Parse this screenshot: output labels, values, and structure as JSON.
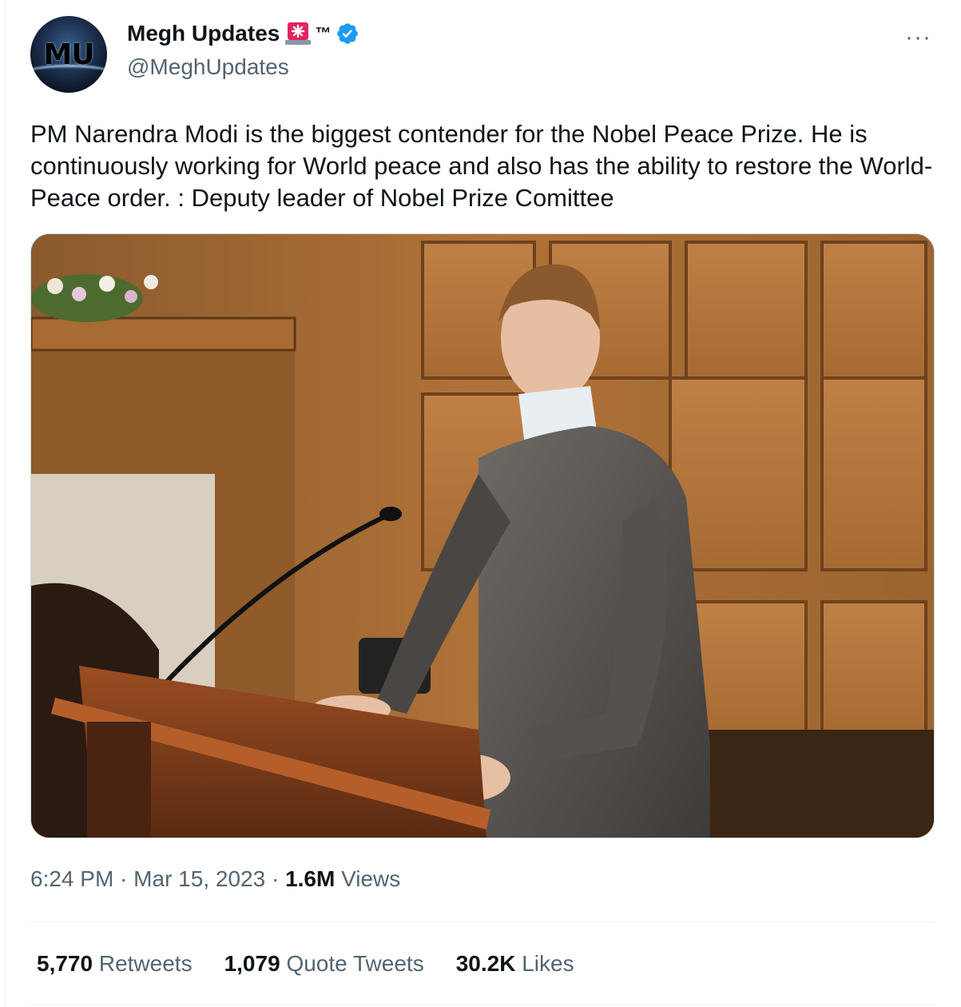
{
  "author": {
    "display_name": "Megh Updates",
    "name_suffix": "™",
    "handle": "@MeghUpdates",
    "avatar_text": "MU",
    "verified": true,
    "emoji_icon": "rotating-light-icon"
  },
  "menu": {
    "more_label": "···"
  },
  "tweet": {
    "text": "PM Narendra Modi is the biggest contender for the Nobel Peace Prize. He is continuously working for World peace and also has the ability to restore the World-Peace order. : Deputy leader of Nobel Prize Comittee",
    "media_alt": "Man in grey suit speaking at a wooden lectern with a microphone in a wood-panelled room"
  },
  "meta": {
    "time": "6:24 PM",
    "separator": " · ",
    "date": "Mar 15, 2023",
    "views_count": "1.6M",
    "views_label": "Views"
  },
  "stats": [
    {
      "count": "5,770",
      "label": "Retweets"
    },
    {
      "count": "1,079",
      "label": "Quote Tweets"
    },
    {
      "count": "30.2K",
      "label": "Likes"
    }
  ],
  "colors": {
    "text_primary": "#0f1419",
    "text_secondary": "#536471",
    "verified_blue": "#1d9bf0",
    "divider": "#eff3f4"
  }
}
